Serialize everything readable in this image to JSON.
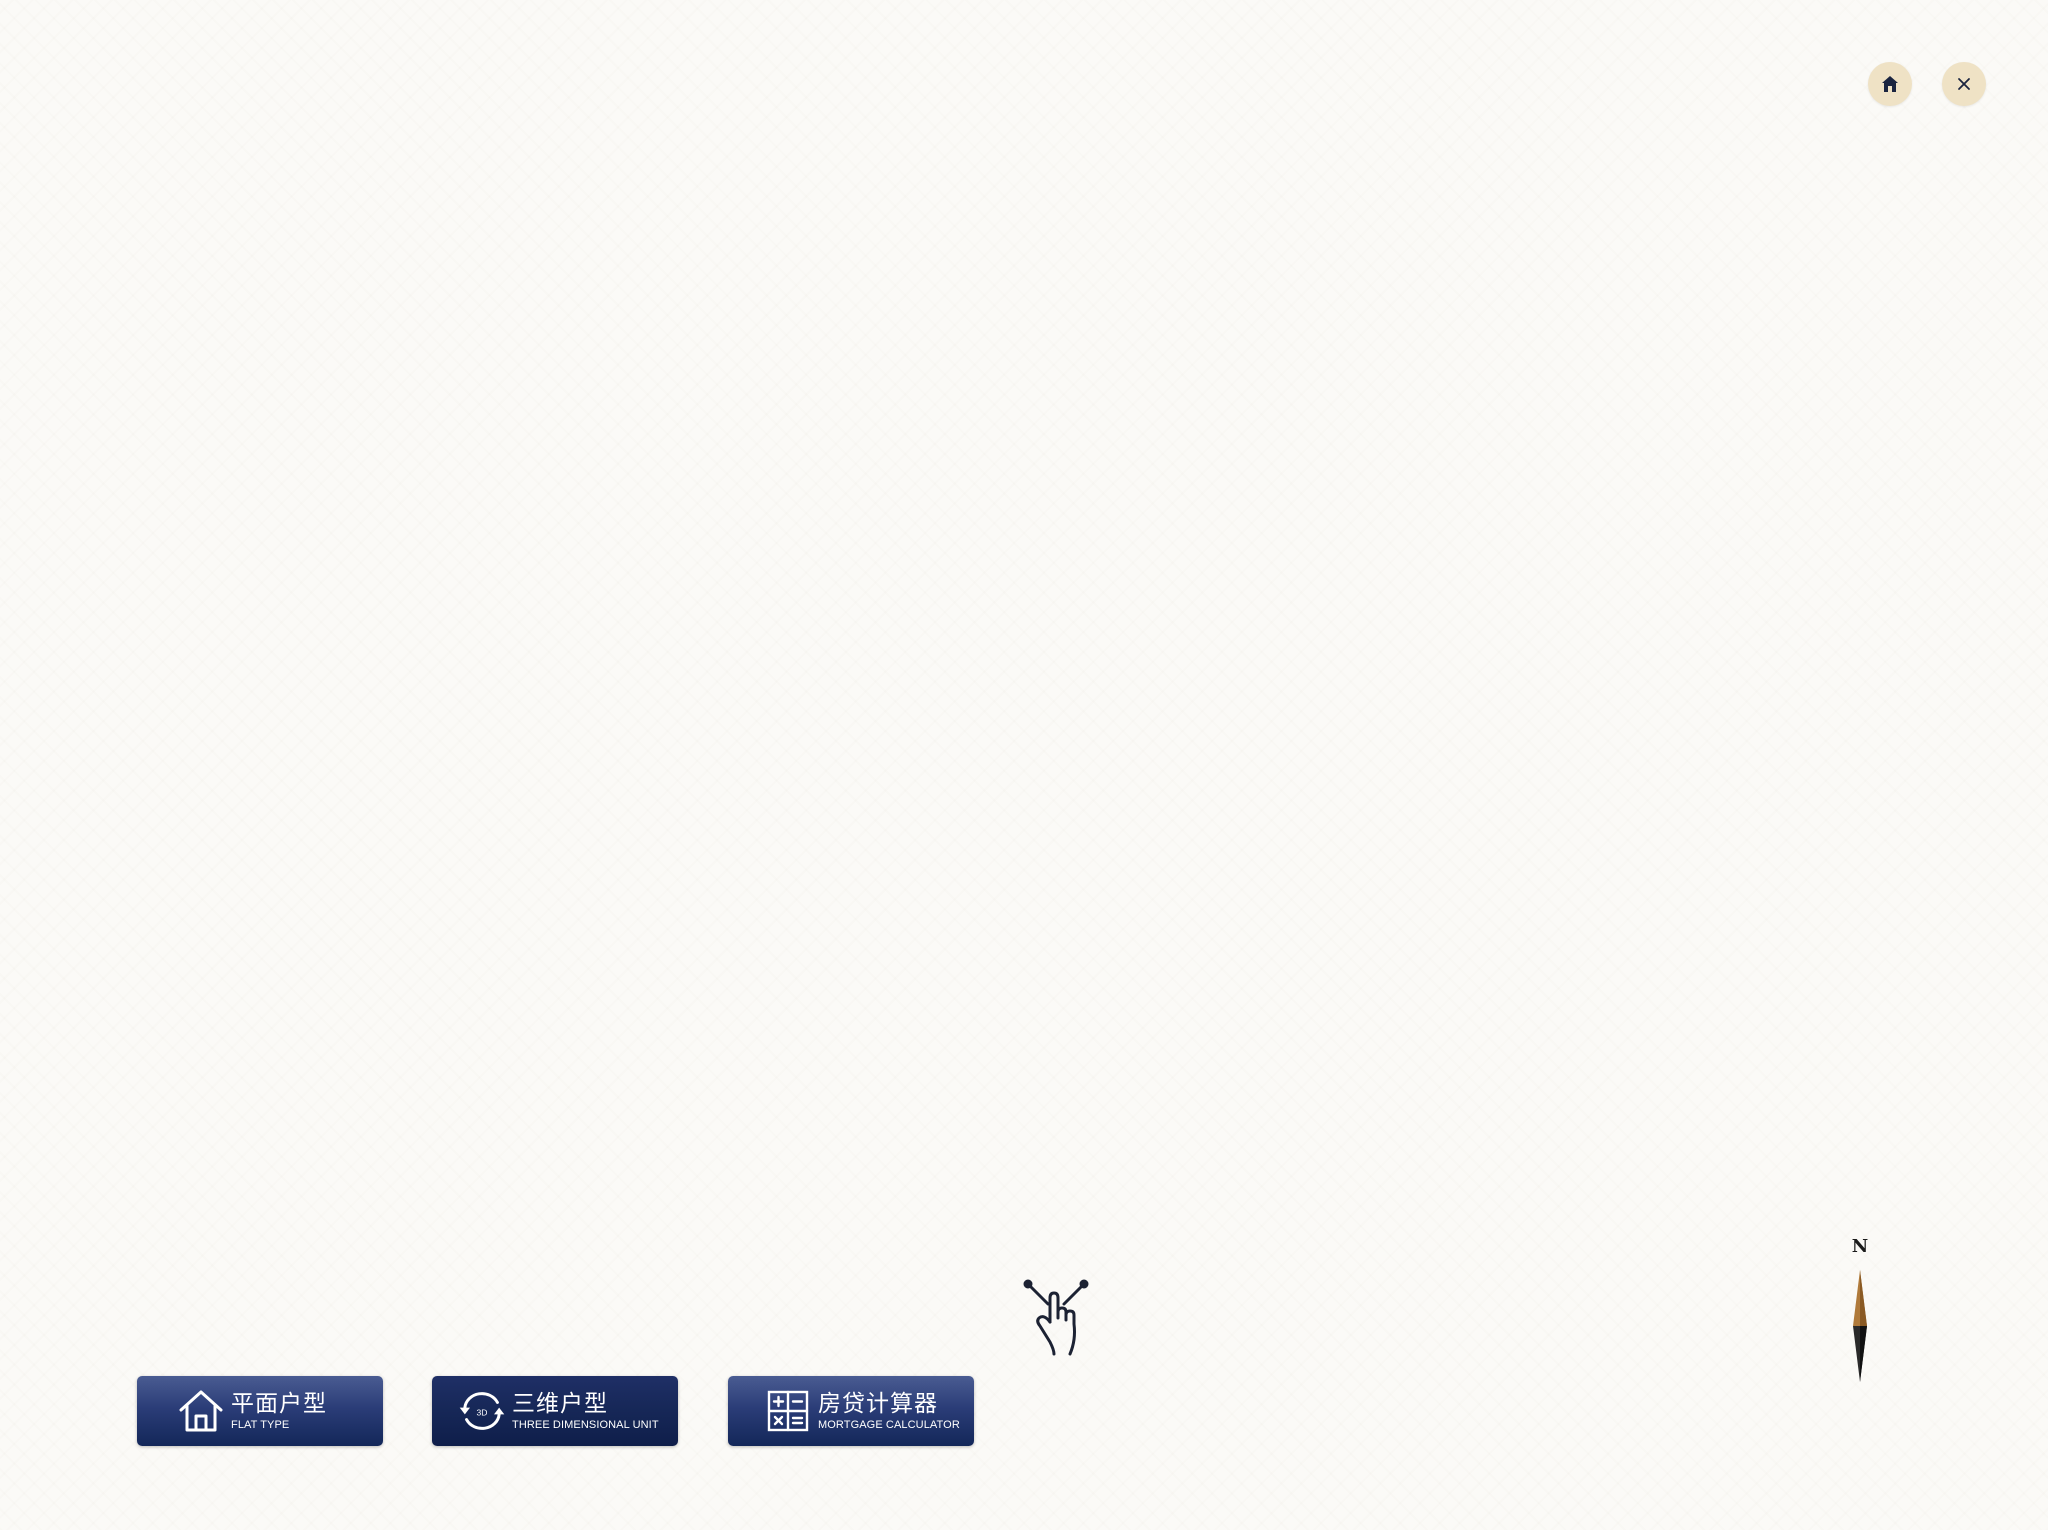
{
  "top_controls": {
    "home_icon": "home-icon",
    "close_icon": "close-icon"
  },
  "compass": {
    "north_label": "N"
  },
  "gesture_hint": {
    "icon": "pinch-zoom-gesture-icon"
  },
  "nav": {
    "flat_type": {
      "label_cn": "平面户型",
      "label_en": "FLAT TYPE",
      "icon": "house-outline-icon"
    },
    "three_d": {
      "label_cn": "三维户型",
      "label_en": "THREE DIMENSIONAL UNIT",
      "icon": "3d-rotate-icon",
      "icon_text": "3D",
      "active": true
    },
    "mortgage": {
      "label_cn": "房贷计算器",
      "label_en": "MORTGAGE CALCULATOR",
      "icon": "calculator-icon"
    }
  },
  "colors": {
    "nav_button": "#22346c",
    "nav_button_active": "#152551",
    "round_button": "#efe2c5",
    "compass_north": "#b07a3a",
    "compass_south": "#2a2a2a"
  }
}
